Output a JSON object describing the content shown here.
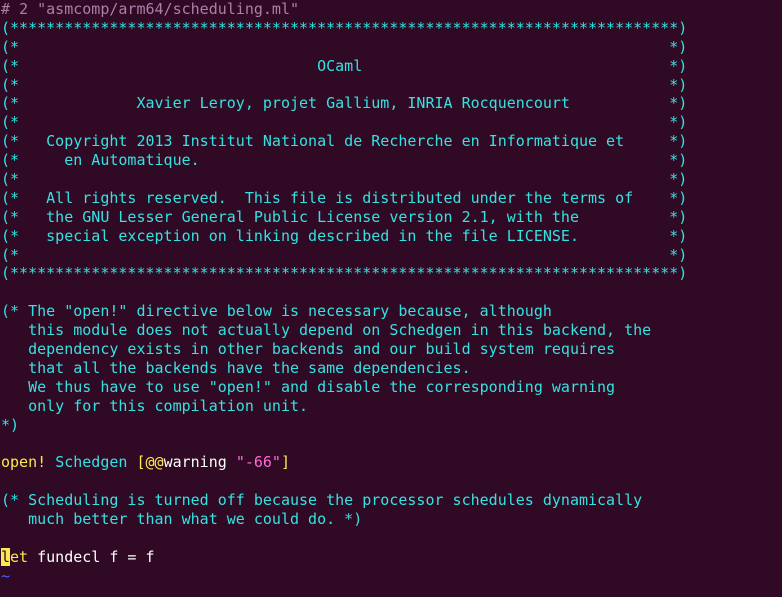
{
  "editor": {
    "header": {
      "hash": "#",
      "line_num": "2",
      "filename": "\"asmcomp/arm64/scheduling.ml\""
    },
    "license_block": [
      "(**************************************************************************)",
      "(*                                                                        *)",
      "(*                                 OCaml                                  *)",
      "(*                                                                        *)",
      "(*             Xavier Leroy, projet Gallium, INRIA Rocquencourt           *)",
      "(*                                                                        *)",
      "(*   Copyright 2013 Institut National de Recherche en Informatique et     *)",
      "(*     en Automatique.                                                    *)",
      "(*                                                                        *)",
      "(*   All rights reserved.  This file is distributed under the terms of    *)",
      "(*   the GNU Lesser General Public License version 2.1, with the          *)",
      "(*   special exception on linking described in the file LICENSE.          *)",
      "(*                                                                        *)",
      "(**************************************************************************)"
    ],
    "blank": "",
    "comment_open": [
      "(* The \"open!\" directive below is necessary because, although",
      "   this module does not actually depend on Schedgen in this backend, the",
      "   dependency exists in other backends and our build system requires",
      "   that all the backends have the same dependencies.",
      "   We thus have to use \"open!\" and disable the corresponding warning",
      "   only for this compilation unit.",
      "*)"
    ],
    "open_line": {
      "kw": "open!",
      "module": "Schedgen",
      "attr_open": "[@@",
      "attr_name": "warning",
      "attr_str": "\"-66\"",
      "attr_close": "]"
    },
    "comment_sched": [
      "(* Scheduling is turned off because the processor schedules dynamically",
      "   much better than what we could do. *)"
    ],
    "let_line": {
      "cursor_char": "l",
      "rest_kw": "et",
      "rest": " fundecl f = f"
    },
    "tilde": "~",
    "colors": {
      "background": "#300a24",
      "comment": "#34e2e2",
      "keyword": "#fce94f",
      "string": "#ff6ad5",
      "header": "#ad7fa8",
      "tilde": "#5c5cff"
    }
  }
}
